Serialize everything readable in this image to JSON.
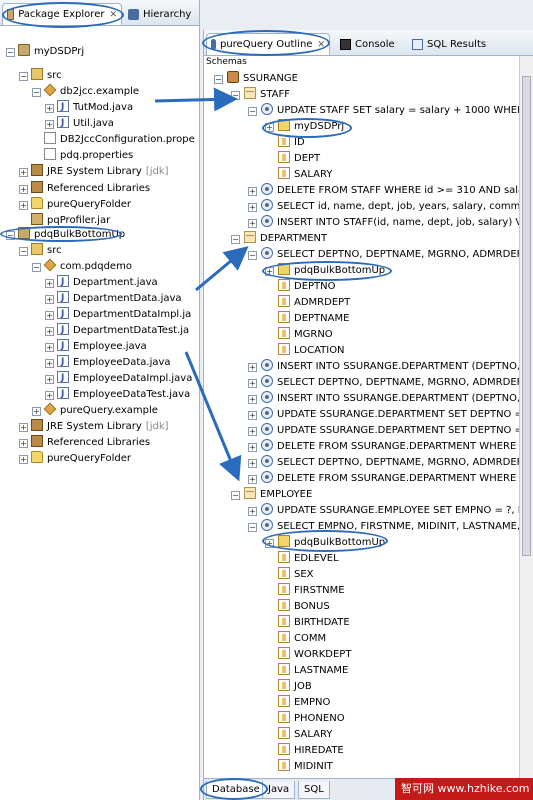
{
  "left_tabs": {
    "package_explorer": "Package Explorer",
    "hierarchy": "Hierarchy"
  },
  "right_tabs": {
    "purequery_outline": "pureQuery Outline",
    "console": "Console",
    "sql_results": "SQL Results"
  },
  "schemas_label": "Schemas",
  "left_tree": [
    {
      "label": "myDSDPrj"
    },
    {
      "label": "src"
    },
    {
      "label": "db2jcc.example"
    },
    {
      "label": "TutMod.java"
    },
    {
      "label": "Util.java"
    },
    {
      "label": "DB2JccConfiguration.prope"
    },
    {
      "label": "pdq.properties"
    },
    {
      "label": "JRE System Library",
      "suffix": "[jdk]"
    },
    {
      "label": "Referenced Libraries"
    },
    {
      "label": "pureQueryFolder"
    },
    {
      "label": "pqProfiler.jar"
    },
    {
      "label": "pdqBulkBottomUp"
    },
    {
      "label": "src"
    },
    {
      "label": "com.pdqdemo"
    },
    {
      "label": "Department.java"
    },
    {
      "label": "DepartmentData.java"
    },
    {
      "label": "DepartmentDataImpl.ja"
    },
    {
      "label": "DepartmentDataTest.ja"
    },
    {
      "label": "Employee.java"
    },
    {
      "label": "EmployeeData.java"
    },
    {
      "label": "EmployeeDataImpl.java"
    },
    {
      "label": "EmployeeDataTest.java"
    },
    {
      "label": "pureQuery.example"
    },
    {
      "label": "JRE System Library",
      "suffix": "[jdk]"
    },
    {
      "label": "Referenced Libraries"
    },
    {
      "label": "pureQueryFolder"
    }
  ],
  "right_tree": [
    {
      "label": "SSURANGE"
    },
    {
      "label": "STAFF"
    },
    {
      "label": "UPDATE STAFF  SET salary = salary + 1000  WHERE id"
    },
    {
      "label": "myDSDPrj"
    },
    {
      "label": "ID"
    },
    {
      "label": "DEPT"
    },
    {
      "label": "SALARY"
    },
    {
      "label": "DELETE FROM STAFF  WHERE id >= 310 AND salary >"
    },
    {
      "label": "SELECT id, name, dept, job, years, salary, comm  FROM"
    },
    {
      "label": "INSERT INTO STAFF(id, name, dept, job, salary)  VALU"
    },
    {
      "label": "DEPARTMENT"
    },
    {
      "label": "SELECT DEPTNO, DEPTNAME, MGRNO, ADMRDEPT, LOC"
    },
    {
      "label": "pdqBulkBottomUp"
    },
    {
      "label": "DEPTNO"
    },
    {
      "label": "ADMRDEPT"
    },
    {
      "label": "DEPTNAME"
    },
    {
      "label": "MGRNO"
    },
    {
      "label": "LOCATION"
    },
    {
      "label": "INSERT INTO SSURANGE.DEPARTMENT (DEPTNO, DEPT"
    },
    {
      "label": "SELECT DEPTNO, DEPTNAME, MGRNO, ADMRDEPT, LOC"
    },
    {
      "label": "INSERT INTO SSURANGE.DEPARTMENT (DEPTNO, DEPT"
    },
    {
      "label": "UPDATE SSURANGE.DEPARTMENT  SET DEPTNO = :dep"
    },
    {
      "label": "UPDATE SSURANGE.DEPARTMENT  SET DEPTNO = ?, DE"
    },
    {
      "label": "DELETE FROM SSURANGE.DEPARTMENT WHERE DEPTN"
    },
    {
      "label": "SELECT DEPTNO, DEPTNAME, MGRNO, ADMRDEPT, LOC"
    },
    {
      "label": "DELETE FROM SSURANGE.DEPARTMENT WHERE DEPTN"
    },
    {
      "label": "EMPLOYEE"
    },
    {
      "label": "UPDATE SSURANGE.EMPLOYEE  SET EMPNO = ?, FIRST"
    },
    {
      "label": "SELECT EMPNO, FIRSTNME, MIDINIT, LASTNAME, WOR"
    },
    {
      "label": "pdqBulkBottomUp"
    },
    {
      "label": "EDLEVEL"
    },
    {
      "label": "SEX"
    },
    {
      "label": "FIRSTNME"
    },
    {
      "label": "BONUS"
    },
    {
      "label": "BIRTHDATE"
    },
    {
      "label": "COMM"
    },
    {
      "label": "WORKDEPT"
    },
    {
      "label": "LASTNAME"
    },
    {
      "label": "JOB"
    },
    {
      "label": "EMPNO"
    },
    {
      "label": "PHONENO"
    },
    {
      "label": "SALARY"
    },
    {
      "label": "HIREDATE"
    },
    {
      "label": "MIDINIT"
    }
  ],
  "bottom_tabs": {
    "database": "Database",
    "java": "Java",
    "sql": "SQL"
  },
  "watermark": "智可网 www.hzhike.com",
  "colors": {
    "highlight": "#2a6bbd",
    "watermark_bg": "#c41a1a"
  }
}
